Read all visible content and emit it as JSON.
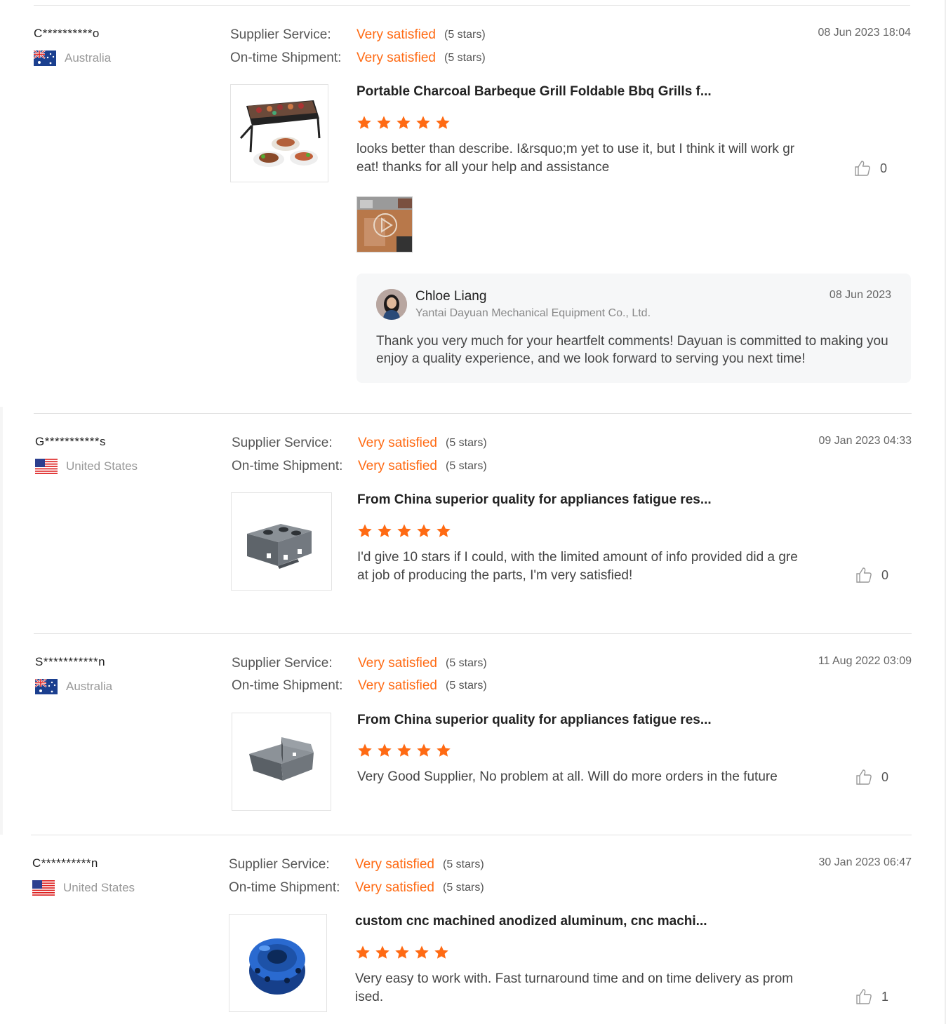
{
  "labels": {
    "supplier_service": "Supplier Service:",
    "ontime_shipment": "On-time Shipment:"
  },
  "reviews": [
    {
      "user": "C**********o",
      "country": "Australia",
      "flag": "australia-flag",
      "date": "08 Jun 2023 18:04",
      "supplier_service": "Very satisfied",
      "supplier_service_stars": "(5 stars)",
      "ontime_shipment": "Very satisfied",
      "ontime_shipment_stars": "(5 stars)",
      "product_title": "Portable Charcoal Barbeque Grill Foldable Bbq Grills f...",
      "product_image": "bbq-grill-image",
      "rating": 5,
      "text": "looks better than describe. I&rsquo;m yet to use it, but I think it will work great! thanks for all your help and assistance",
      "likes": "0",
      "has_video": true,
      "reply": {
        "name": "Chloe Liang",
        "company": "Yantai Dayuan Mechanical Equipment Co., Ltd.",
        "date": "08 Jun 2023",
        "text": "Thank you very much for your heartfelt comments! Dayuan is committed to making you enjoy a quality experience, and we look forward to serving you next time!"
      }
    },
    {
      "user": "G***********s",
      "country": "United States",
      "flag": "us-flag",
      "date": "09 Jan 2023 04:33",
      "supplier_service": "Very satisfied",
      "supplier_service_stars": "(5 stars)",
      "ontime_shipment": "Very satisfied",
      "ontime_shipment_stars": "(5 stars)",
      "product_title": "From China superior quality for appliances fatigue res...",
      "product_image": "metal-bracket-image",
      "rating": 5,
      "text": "I'd give 10 stars if I could, with the limited amount of info provided did a great job of producing the parts, I'm very satisfied!",
      "likes": "0"
    },
    {
      "user": "S***********n",
      "country": "Australia",
      "flag": "australia-flag",
      "date": "11 Aug 2022 03:09",
      "supplier_service": "Very satisfied",
      "supplier_service_stars": "(5 stars)",
      "ontime_shipment": "Very satisfied",
      "ontime_shipment_stars": "(5 stars)",
      "product_title": "From China superior quality for appliances fatigue res...",
      "product_image": "sheet-metal-tray-image",
      "rating": 5,
      "text": "Very Good Supplier, No problem at all. Will do more orders in the future",
      "likes": "0"
    },
    {
      "user": "C**********n",
      "country": "United States",
      "flag": "us-flag",
      "date": "30 Jan 2023 06:47",
      "supplier_service": "Very satisfied",
      "supplier_service_stars": "(5 stars)",
      "ontime_shipment": "Very satisfied",
      "ontime_shipment_stars": "(5 stars)",
      "product_title": "custom cnc machined anodized aluminum, cnc machi...",
      "product_image": "cnc-anodized-part-image",
      "rating": 5,
      "text": "Very easy to work with.  Fast turnaround time and on time delivery as promised.",
      "likes": "1"
    }
  ],
  "colors": {
    "accent": "#ff6a13",
    "star": "#ff6a13",
    "divider": "#e1e1e1",
    "reply_bg": "#f6f7f8"
  }
}
